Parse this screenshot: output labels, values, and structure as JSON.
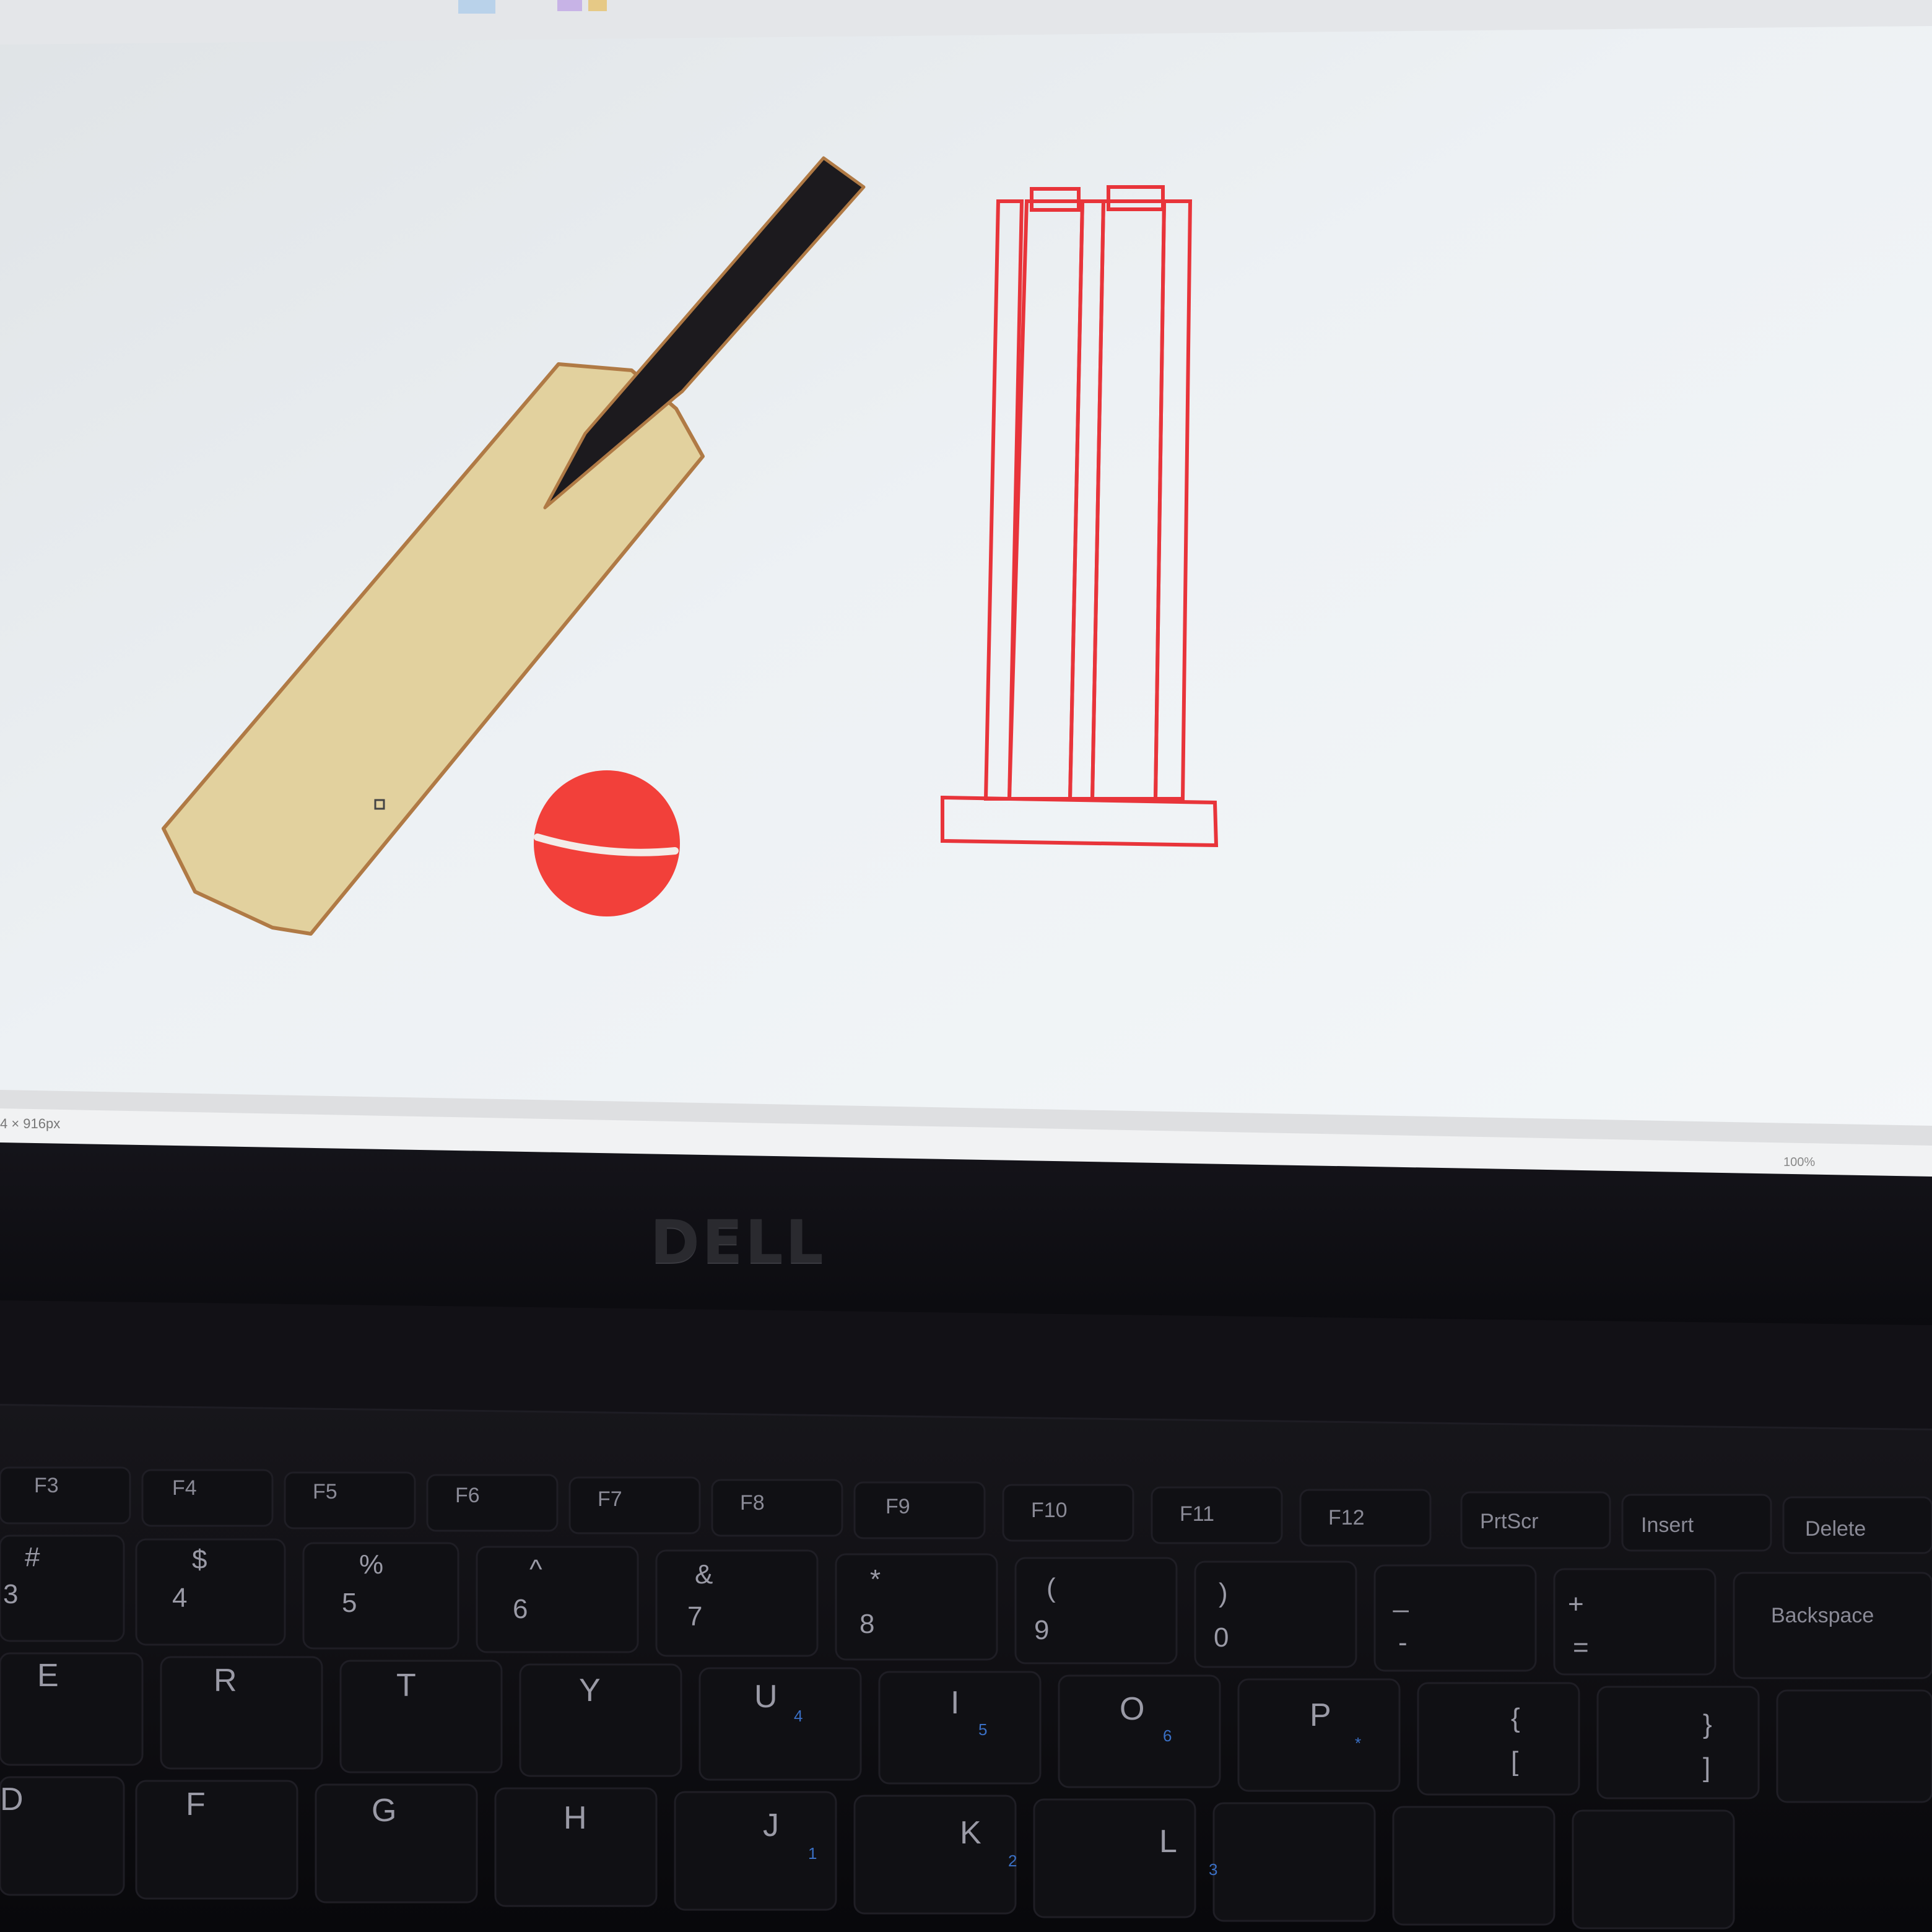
{
  "app": {
    "status_dimensions": "4 × 916px",
    "zoom_label": "100%"
  },
  "canvas_drawing": {
    "objects": [
      "cricket-bat",
      "cricket-ball",
      "cricket-stumps"
    ],
    "colors": {
      "bat_blade": "#e2d19e",
      "bat_outline": "#b07a45",
      "bat_handle": "#1c1a1e",
      "ball": "#f2403a",
      "ball_seam": "#f3ece8",
      "stumps_stroke": "#e8343a",
      "canvas_bg": "#edf1f4"
    }
  },
  "laptop": {
    "logo": "DELL",
    "function_keys": [
      "F3",
      "F4",
      "F5",
      "F6",
      "F7",
      "F8",
      "F9",
      "F10",
      "F11",
      "F12",
      "PrtScr",
      "Insert",
      "Delete"
    ],
    "number_row": [
      {
        "top": "#",
        "bottom": "3"
      },
      {
        "top": "$",
        "bottom": "4"
      },
      {
        "top": "%",
        "bottom": "5"
      },
      {
        "top": "^",
        "bottom": "6"
      },
      {
        "top": "&",
        "bottom": "7"
      },
      {
        "top": "*",
        "bottom": "8"
      },
      {
        "top": "(",
        "bottom": "9"
      },
      {
        "top": ")",
        "bottom": "0"
      },
      {
        "top": "_",
        "bottom": "-"
      },
      {
        "top": "+",
        "bottom": "="
      },
      {
        "top": "Backspace",
        "bottom": ""
      }
    ],
    "letter_row_1": [
      "E",
      "R",
      "T",
      "Y",
      "U",
      "I",
      "O",
      "P",
      "{",
      "}"
    ],
    "letter_row_1_bottom": [
      "[",
      "]"
    ],
    "letter_row_2": [
      "D",
      "F",
      "G",
      "H",
      "J",
      "K",
      "L"
    ],
    "numpad_subs": [
      "4",
      "5",
      "6",
      "*",
      "1",
      "2",
      "3"
    ]
  }
}
